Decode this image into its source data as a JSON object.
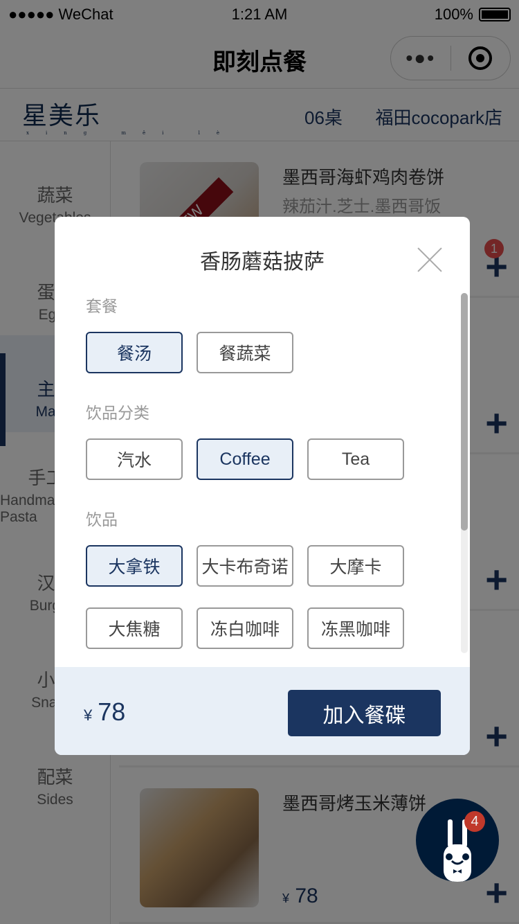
{
  "status": {
    "carrier": "●●●●● WeChat",
    "time": "1:21 AM",
    "battery": "100%"
  },
  "nav": {
    "title": "即刻点餐",
    "more": "•●•"
  },
  "shop": {
    "logo": "星美乐",
    "logo_pinyin": "xing měi lè",
    "table": "06桌",
    "store": "福田cocopark店"
  },
  "sidebar": {
    "items": [
      {
        "zh": "蔬菜",
        "en": "Vegetables"
      },
      {
        "zh": "蛋类",
        "en": "Eggs"
      },
      {
        "zh": "主菜",
        "en": "Mains",
        "selected": true
      },
      {
        "zh": "手工制",
        "en": "Handmade Pasta"
      },
      {
        "zh": "汉堡",
        "en": "Burgers"
      },
      {
        "zh": "小吃",
        "en": "Snacks"
      },
      {
        "zh": "配菜",
        "en": "Sides"
      }
    ]
  },
  "items": [
    {
      "name": "墨西哥海虾鸡肉卷饼",
      "desc": "辣茄汁.芝士.墨西哥饭",
      "ribbon": "NEW",
      "badge": "1"
    },
    {},
    {},
    {},
    {
      "name": "墨西哥烤玉米薄饼",
      "currency": "¥",
      "price": "78"
    }
  ],
  "cart": {
    "count": "4"
  },
  "modal": {
    "title": "香肠蘑菇披萨",
    "groups": [
      {
        "label": "套餐",
        "options": [
          {
            "label": "餐汤",
            "selected": true
          },
          {
            "label": "餐蔬菜"
          }
        ]
      },
      {
        "label": "饮品分类",
        "options": [
          {
            "label": "汽水"
          },
          {
            "label": "Coffee",
            "selected": true
          },
          {
            "label": "Tea"
          }
        ]
      },
      {
        "label": "饮品",
        "options": [
          {
            "label": "大拿铁",
            "selected": true
          },
          {
            "label": "大卡布奇诺"
          },
          {
            "label": "大摩卡"
          },
          {
            "label": "大焦糖"
          },
          {
            "label": "冻白咖啡"
          },
          {
            "label": "冻黑咖啡"
          }
        ]
      }
    ],
    "currency": "¥",
    "total": "78",
    "add_label": "加入餐碟",
    "scroll_fraction": 0.66
  },
  "colors": {
    "accent": "#1b3560",
    "selected_bg": "#e8eff7",
    "badge": "#e74c4c"
  }
}
